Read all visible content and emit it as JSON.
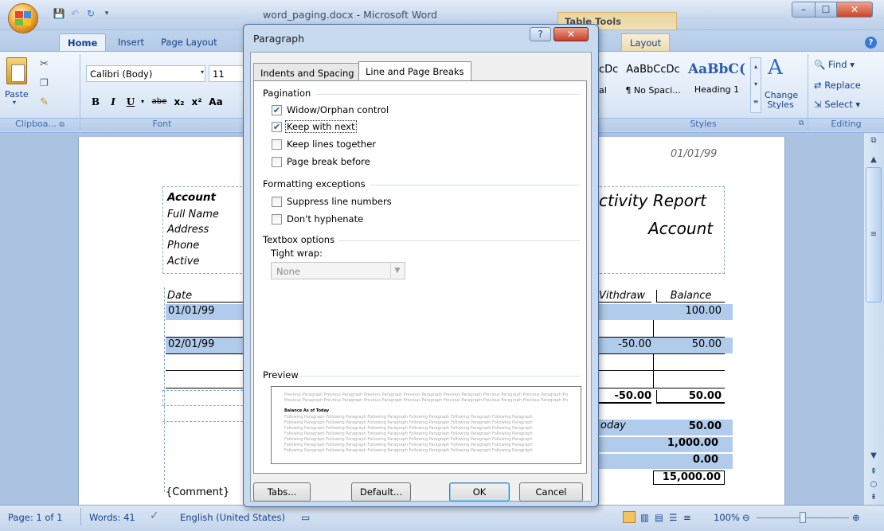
{
  "window": {
    "title": "word_paging.docx - Microsoft Word",
    "contextual_tab_group": "Table Tools",
    "controls": {
      "minimize": "–",
      "maximize": "☐",
      "close": "✕"
    }
  },
  "quick_access": {
    "save_icon": "save-icon",
    "undo_icon": "undo-icon",
    "redo_icon": "redo-icon"
  },
  "ribbon_tabs": [
    "Home",
    "Insert",
    "Page Layout",
    "Layout"
  ],
  "ribbon": {
    "clipboard": {
      "paste_label": "Paste",
      "group_label": "Clipboa..."
    },
    "font": {
      "font_name": "Calibri (Body)",
      "font_size": "11",
      "group_label": "Font",
      "buttons": [
        "B",
        "I",
        "U",
        "abe",
        "x₂",
        "x²",
        "Aa"
      ]
    },
    "styles": {
      "group_label": "Styles",
      "tiles": [
        {
          "preview": "cDc",
          "name": "al"
        },
        {
          "preview": "AaBbCcDc",
          "name": "¶ No Spaci..."
        },
        {
          "preview": "AaBbC(",
          "name": "Heading 1"
        }
      ],
      "change_styles": "Change Styles"
    },
    "editing": {
      "find": "Find",
      "replace": "Replace",
      "select": "Select",
      "group_label": "Editing"
    }
  },
  "document": {
    "date_header": "01/01/99",
    "left_labels": [
      "Account",
      "Full Name",
      "Address",
      "Phone",
      "Active"
    ],
    "title_lines": [
      "ctivity Report",
      "Account"
    ],
    "table_header": {
      "date": "Date",
      "withdraw": "Vithdraw",
      "balance": "Balance"
    },
    "rows": [
      {
        "date": "01/01/99",
        "withdraw": "",
        "balance": "100.00"
      },
      {
        "date": "02/01/99",
        "withdraw": "-50.00",
        "balance": "50.00"
      }
    ],
    "totals": {
      "withdraw": "-50.00",
      "balance": "50.00"
    },
    "summary_label": "oday",
    "summary_values": [
      "50.00",
      "1,000.00",
      "0.00",
      "15,000.00"
    ],
    "comment": "{Comment}"
  },
  "dialog": {
    "title": "Paragraph",
    "tabs": [
      "Indents and Spacing",
      "Line and Page Breaks"
    ],
    "active_tab": "Line and Page Breaks",
    "pagination": {
      "label": "Pagination",
      "options": [
        {
          "label": "Widow/Orphan control",
          "checked": true
        },
        {
          "label": "Keep with next",
          "checked": true
        },
        {
          "label": "Keep lines together",
          "checked": false
        },
        {
          "label": "Page break before",
          "checked": false
        }
      ]
    },
    "formatting": {
      "label": "Formatting exceptions",
      "options": [
        {
          "label": "Suppress line numbers",
          "checked": false
        },
        {
          "label": "Don't hyphenate",
          "checked": false
        }
      ]
    },
    "textbox": {
      "label": "Textbox options",
      "tight_wrap_label": "Tight wrap:",
      "tight_wrap_value": "None"
    },
    "preview": {
      "label": "Preview",
      "previous_text": "Previous Paragraph Previous Paragraph Previous Paragraph Previous Paragraph Previous Paragraph Previous Paragraph Previous Paragraph Previous Paragraph Previous Paragraph Previous Paragraph",
      "current_text": "Balance As of Today",
      "following_text": "Following Paragraph Following Paragraph Following Paragraph Following Paragraph Following Paragraph Following Paragraph"
    },
    "buttons": {
      "tabs": "Tabs...",
      "default": "Default...",
      "ok": "OK",
      "cancel": "Cancel"
    }
  },
  "status": {
    "page": "Page: 1 of 1",
    "words": "Words: 41",
    "language": "English (United States)",
    "zoom": "100%"
  }
}
